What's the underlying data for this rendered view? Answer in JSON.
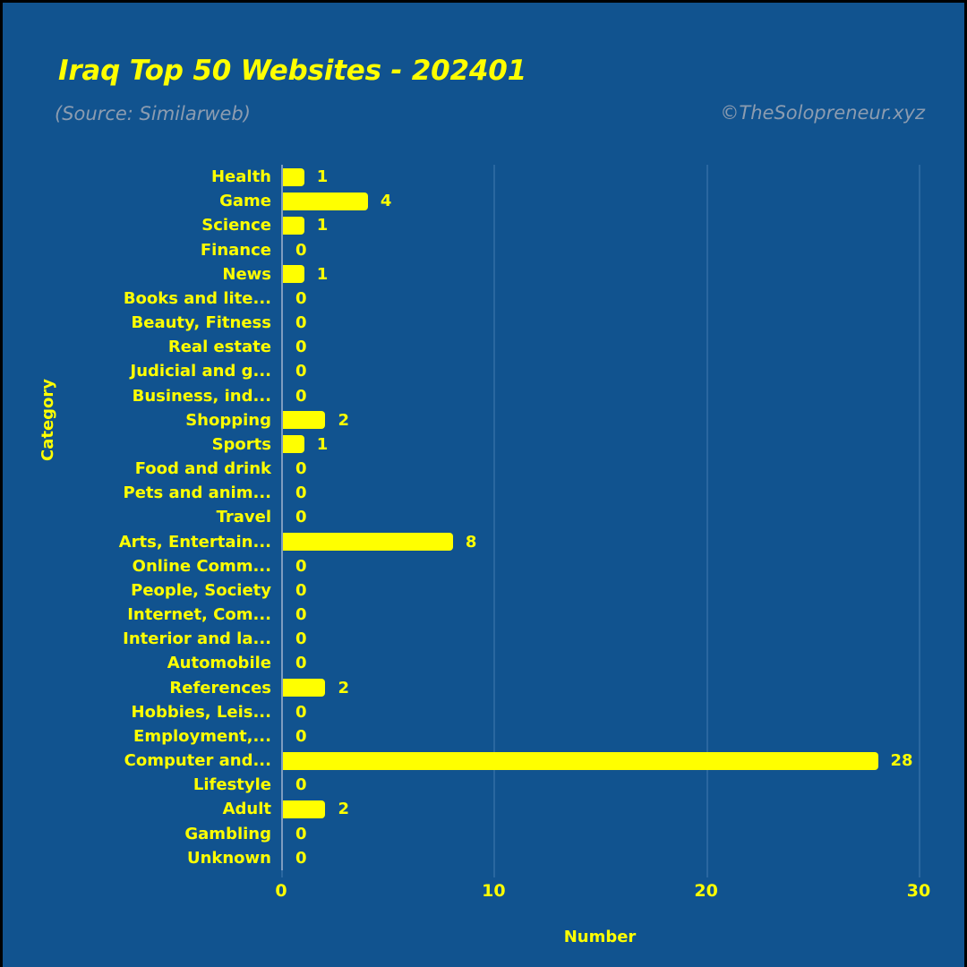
{
  "header": {
    "title": "Iraq Top 50 Websites - 202401",
    "subtitle": "(Source: Similarweb)",
    "watermark": "©TheSolopreneur.xyz"
  },
  "colors": {
    "background": "#11538f",
    "bar": "#ffff00",
    "text": "#ffff00",
    "muted_text": "#8c9cb0",
    "gridline": "#2a67a0",
    "axis": "#7e9cc0"
  },
  "chart_data": {
    "type": "bar",
    "orientation": "horizontal",
    "title": "Iraq Top 50 Websites - 202401",
    "subtitle": "(Source: Similarweb)",
    "xlabel": "Number",
    "ylabel": "Category",
    "xlim": [
      0,
      30
    ],
    "xticks": [
      0,
      10,
      20,
      30
    ],
    "xtick_labels": [
      "0",
      "10",
      "20",
      "30"
    ],
    "grid": true,
    "legend": false,
    "categories": [
      "Health",
      "Game",
      "Science",
      "Finance",
      "News",
      "Books and lite...",
      "Beauty, Fitness",
      "Real estate",
      "Judicial and g...",
      "Business, ind...",
      "Shopping",
      "Sports",
      "Food and drink",
      "Pets and anim...",
      "Travel",
      "Arts, Entertain...",
      "Online Comm...",
      "People, Society",
      "Internet, Com...",
      "Interior and la...",
      "Automobile",
      "References",
      "Hobbies, Leis...",
      "Employment,...",
      "Computer and...",
      "Lifestyle",
      "Adult",
      "Gambling",
      "Unknown"
    ],
    "values": [
      1,
      4,
      1,
      0,
      1,
      0,
      0,
      0,
      0,
      0,
      2,
      1,
      0,
      0,
      0,
      8,
      0,
      0,
      0,
      0,
      0,
      2,
      0,
      0,
      28,
      0,
      2,
      0,
      0
    ],
    "value_labels": [
      "1",
      "4",
      "1",
      "0",
      "1",
      "0",
      "0",
      "0",
      "0",
      "0",
      "2",
      "1",
      "0",
      "0",
      "0",
      "8",
      "0",
      "0",
      "0",
      "0",
      "0",
      "2",
      "0",
      "0",
      "28",
      "0",
      "2",
      "0",
      "0"
    ]
  }
}
